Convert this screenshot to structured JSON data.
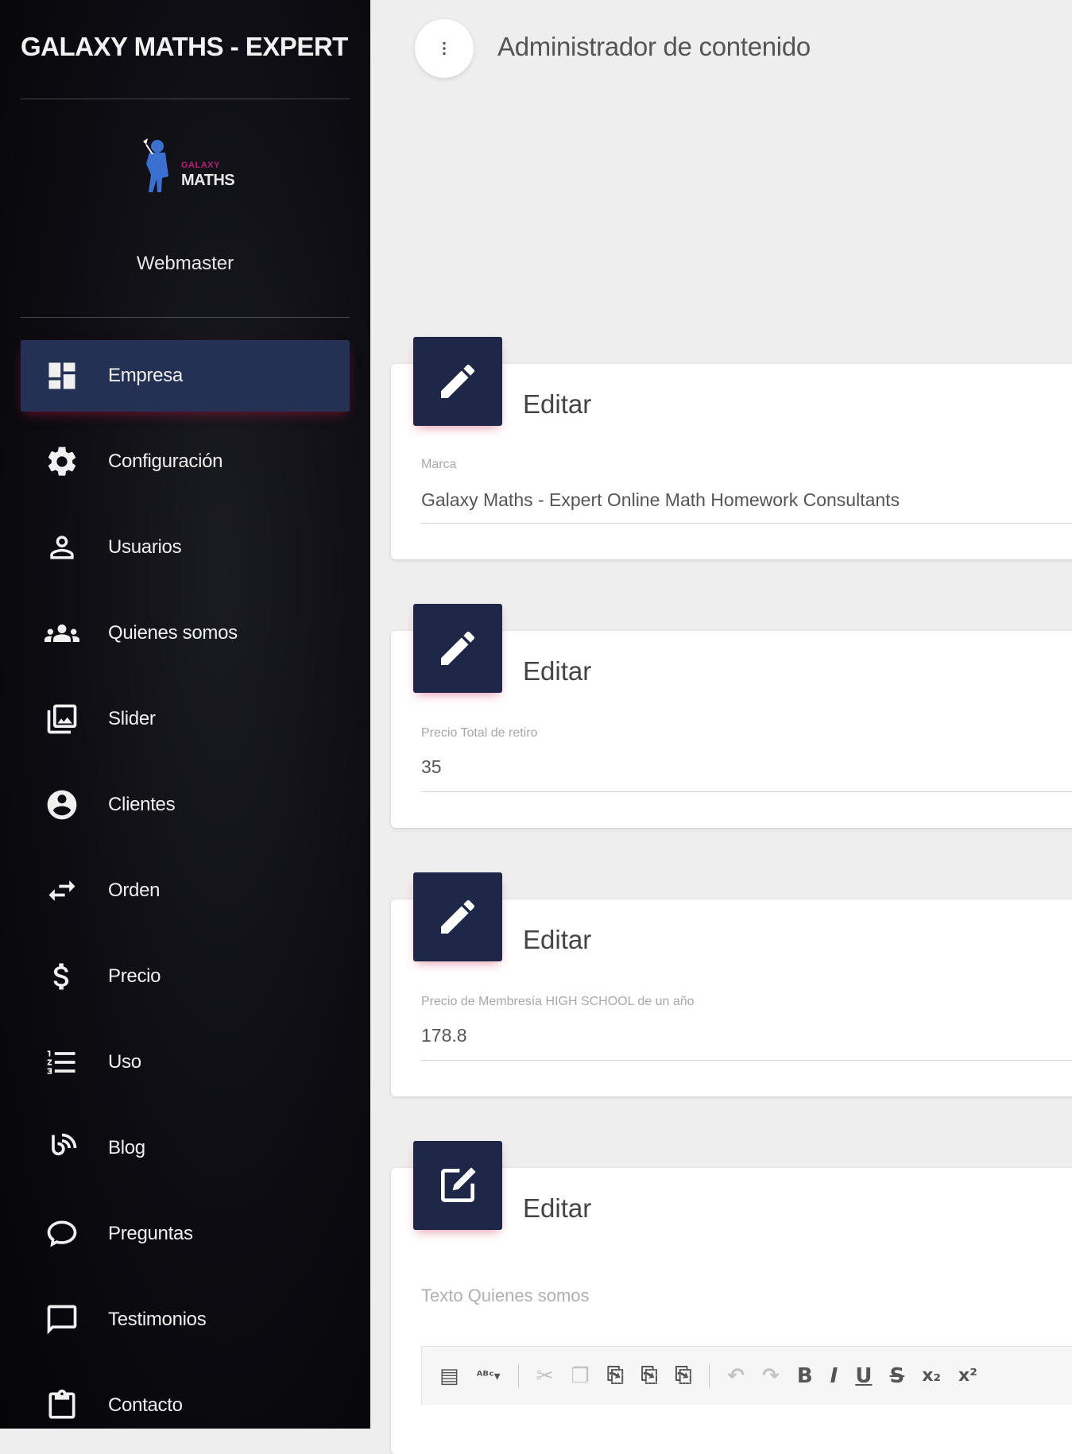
{
  "sidebar": {
    "brand_title": "GALAXY MATHS - EXPERT ONLINE MATH HOMEWORK CONSULTANTS",
    "logo_small": "GALAXY",
    "logo_text": "MATHS",
    "username": "Webmaster",
    "items": [
      {
        "label": "Empresa",
        "icon": "dashboard-icon",
        "active": true
      },
      {
        "label": "Configuración",
        "icon": "gear-icon"
      },
      {
        "label": "Usuarios",
        "icon": "user-icon"
      },
      {
        "label": "Quienes somos",
        "icon": "group-icon"
      },
      {
        "label": "Slider",
        "icon": "images-icon"
      },
      {
        "label": "Clientes",
        "icon": "account-circle-icon"
      },
      {
        "label": "Orden",
        "icon": "swap-arrows-icon"
      },
      {
        "label": "Precio",
        "icon": "dollar-icon"
      },
      {
        "label": "Uso",
        "icon": "numbered-list-icon"
      },
      {
        "label": "Blog",
        "icon": "blog-icon"
      },
      {
        "label": "Preguntas",
        "icon": "chat-bubble-icon"
      },
      {
        "label": "Testimonios",
        "icon": "comment-icon"
      },
      {
        "label": "Contacto",
        "icon": "clipboard-icon"
      }
    ]
  },
  "header": {
    "title": "Administrador de contenido"
  },
  "cards": [
    {
      "title": "Editar",
      "field_label": "Marca",
      "field_value": "Galaxy Maths -  Expert Online Math Homework Consultants"
    },
    {
      "title": "Editar",
      "field_label": "Precio Total de retiro",
      "field_value": "35"
    },
    {
      "title": "Editar",
      "field_label": "Precio de Membresía HIGH SCHOOL de un año",
      "field_value": "178.8"
    },
    {
      "title": "Editar",
      "field_label": "Texto Quienes somos"
    }
  ],
  "editor_toolbar": {
    "buttons": [
      "source",
      "spellcheck",
      "cut",
      "copy",
      "paste",
      "paste-text",
      "paste-word",
      "undo",
      "redo",
      "bold",
      "italic",
      "underline",
      "strike",
      "subscript",
      "superscript"
    ],
    "glyphs": {
      "source": "▤",
      "spellcheck": "ᴬᴮᶜ▾",
      "cut": "✂",
      "copy": "❐",
      "paste": "⎘",
      "paste_text": "⎘",
      "paste_word": "⎘",
      "undo": "↶",
      "redo": "↷",
      "bold": "B",
      "italic": "I",
      "underline": "U",
      "strike": "S",
      "subscript": "x₂",
      "superscript": "x²"
    }
  },
  "colors": {
    "sidebar_bg": "#0c0c12",
    "accent": "#253055",
    "card_icon_bg": "#1f2749",
    "shadow_accent": "#be143c",
    "content_bg": "#eeeeee"
  }
}
